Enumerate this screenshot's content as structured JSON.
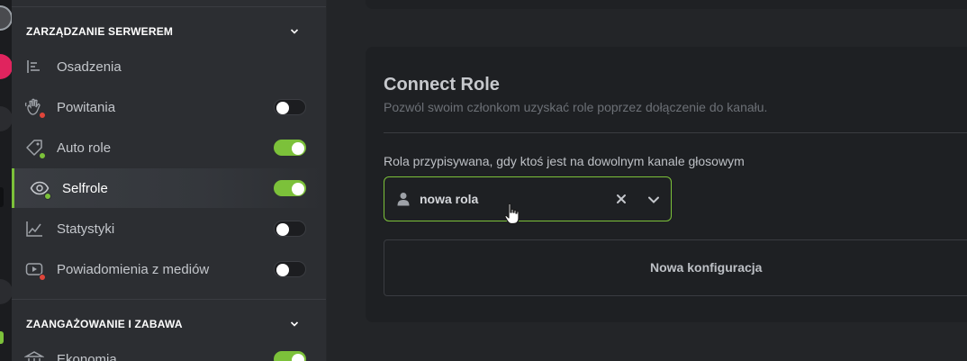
{
  "sidebar": {
    "sections": [
      {
        "title": "ZARZĄDZANIE SERWEREM"
      },
      {
        "title": "ZAANGAŻOWANIE I ZABAWA"
      }
    ],
    "items": [
      {
        "label": "Osadzenia",
        "icon": "embed-icon"
      },
      {
        "label": "Powitania",
        "icon": "waving-hand-icon",
        "status": "red",
        "toggle": false
      },
      {
        "label": "Auto role",
        "icon": "tag-icon",
        "status": "green",
        "toggle": true
      },
      {
        "label": "Selfrole",
        "icon": "eye-icon",
        "status": "green",
        "toggle": true,
        "active": true
      },
      {
        "label": "Statystyki",
        "icon": "line-chart-icon",
        "toggle": false
      },
      {
        "label": "Powiadomienia z mediów",
        "icon": "video-play-icon",
        "status": "red",
        "toggle": false
      },
      {
        "label": "Ekonomia",
        "icon": "bank-icon",
        "toggle": true
      }
    ]
  },
  "main": {
    "card_title": "Connect Role",
    "card_subtitle": "Pozwól swoim członkom uzyskać role poprzez dołączenie do kanału.",
    "field_label": "Rola przypisywana, gdy ktoś jest na dowolnym kanale głosowym",
    "select_value": "nowa rola",
    "new_config_label": "Nowa konfiguracja"
  },
  "colors": {
    "accent": "#7cc13a",
    "sidebar_bg": "#2c2e32",
    "main_bg": "#232528",
    "card_bg": "#1e2023",
    "status_red": "#e0453a"
  }
}
